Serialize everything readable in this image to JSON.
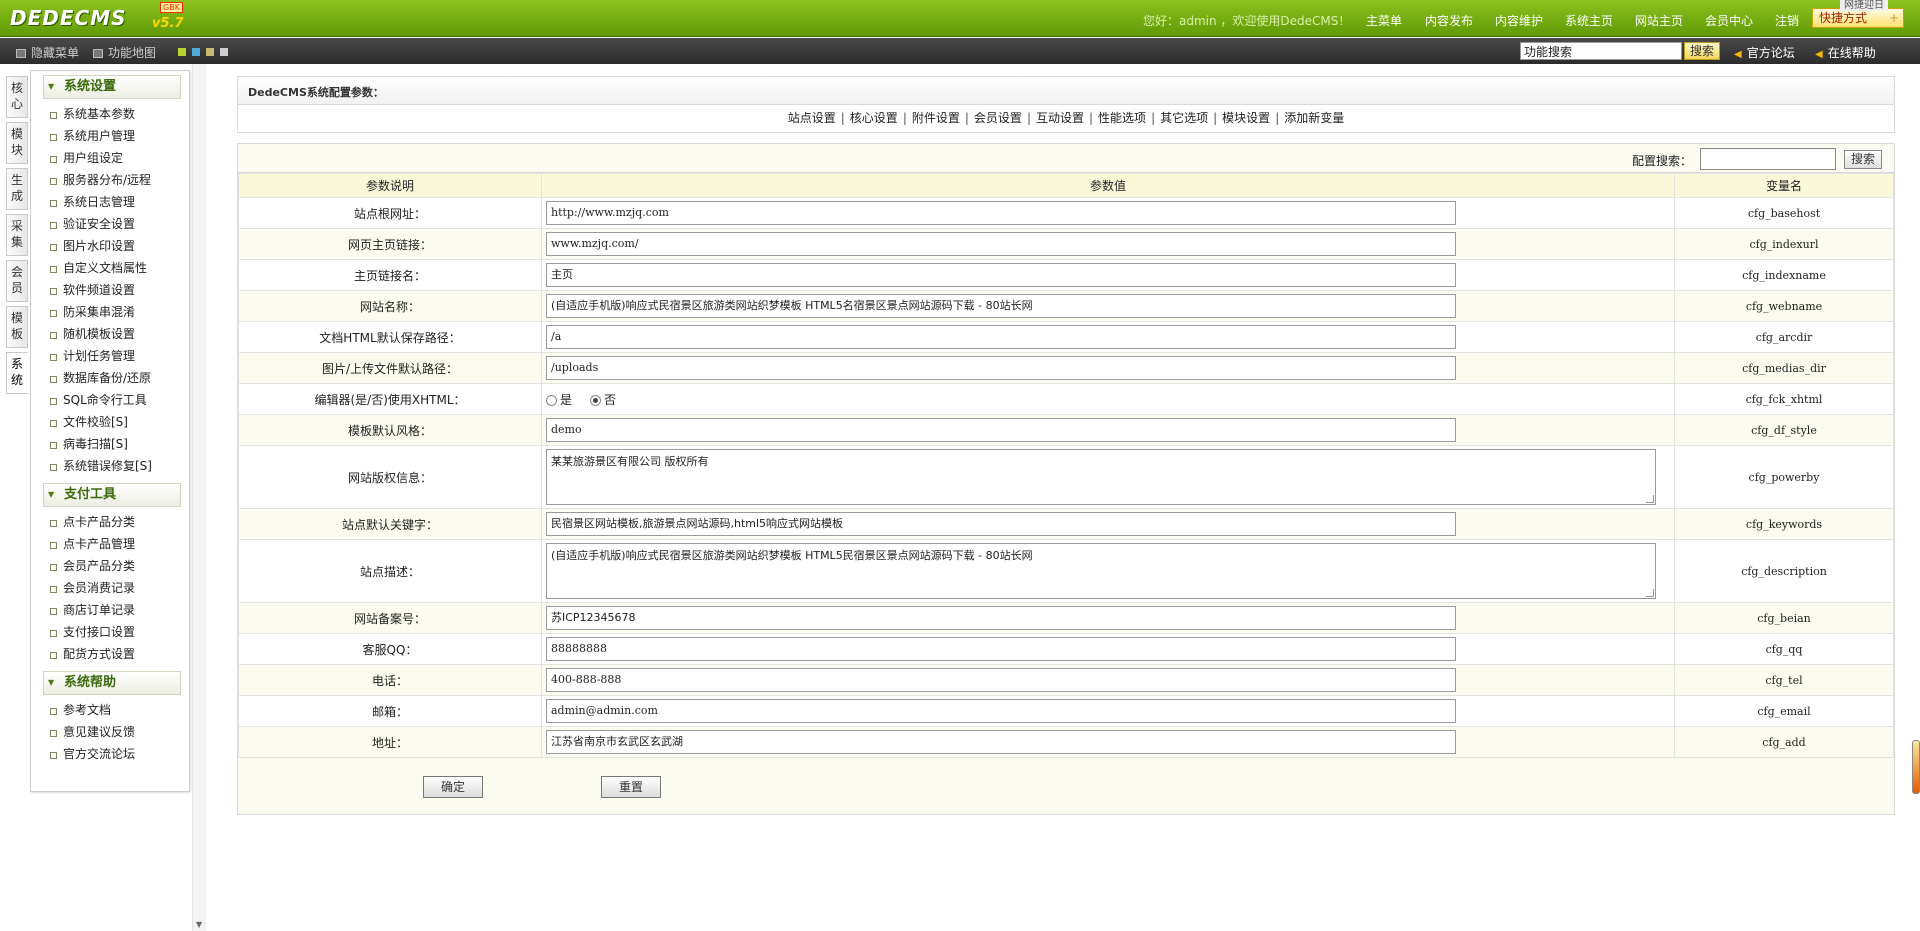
{
  "header": {
    "logo": "DEDECMS",
    "version": "v5.7",
    "edition_badge": "GBK",
    "welcome": "您好：admin ，欢迎使用DedeCMS！",
    "nav": [
      "主菜单",
      "内容发布",
      "内容维护",
      "系统主页",
      "网站主页",
      "会员中心",
      "注销"
    ],
    "quick_label": "快捷方式",
    "quick_tip": "网捷迎日"
  },
  "toolbar": {
    "hide_menu": "隐藏菜单",
    "func_map": "功能地图",
    "search_value": "功能搜索",
    "search_btn": "搜索",
    "forum": "官方论坛",
    "help": "在线帮助",
    "swatch_colors": [
      "#b8d430",
      "#4fa8d8",
      "#c9b870",
      "#cfcfcf"
    ]
  },
  "vtabs": [
    {
      "label": "核心",
      "active": false
    },
    {
      "label": "模块",
      "active": false
    },
    {
      "label": "生成",
      "active": false
    },
    {
      "label": "采集",
      "active": false
    },
    {
      "label": "会员",
      "active": false
    },
    {
      "label": "模板",
      "active": false
    },
    {
      "label": "系统",
      "active": true
    }
  ],
  "menu": [
    {
      "title": "系统设置",
      "items": [
        "系统基本参数",
        "系统用户管理",
        "用户组设定",
        "服务器分布/远程",
        "系统日志管理",
        "验证安全设置",
        "图片水印设置",
        "自定义文档属性",
        "软件频道设置",
        "防采集串混淆",
        "随机模板设置",
        "计划任务管理",
        "数据库备份/还原",
        "SQL命令行工具",
        "文件校验[S]",
        "病毒扫描[S]",
        "系统错误修复[S]"
      ]
    },
    {
      "title": "支付工具",
      "items": [
        "点卡产品分类",
        "点卡产品管理",
        "会员产品分类",
        "会员消费记录",
        "商店订单记录",
        "支付接口设置",
        "配货方式设置"
      ]
    },
    {
      "title": "系统帮助",
      "items": [
        "参考文档",
        "意见建议反馈",
        "官方交流论坛"
      ]
    }
  ],
  "main": {
    "title": "DedeCMS系统配置参数：",
    "tabs": [
      "站点设置",
      "核心设置",
      "附件设置",
      "会员设置",
      "互动设置",
      "性能选项",
      "其它选项",
      "模块设置",
      "添加新变量"
    ],
    "search_label": "配置搜索：",
    "search_btn": "搜索",
    "columns": [
      "参数说明",
      "参数值",
      "变量名"
    ],
    "rows": [
      {
        "label": "站点根网址：",
        "value": "http://www.mzjq.com",
        "var": "cfg_basehost",
        "type": "input"
      },
      {
        "label": "网页主页链接：",
        "value": "www.mzjq.com/",
        "var": "cfg_indexurl",
        "type": "input"
      },
      {
        "label": "主页链接名：",
        "value": "主页",
        "var": "cfg_indexname",
        "type": "input"
      },
      {
        "label": "网站名称：",
        "value": "(自适应手机版)响应式民宿景区旅游类网站织梦模板 HTML5名宿景区景点网站源码下载 - 80站长网",
        "var": "cfg_webname",
        "type": "input"
      },
      {
        "label": "文档HTML默认保存路径：",
        "value": "/a",
        "var": "cfg_arcdir",
        "type": "input"
      },
      {
        "label": "图片/上传文件默认路径：",
        "value": "/uploads",
        "var": "cfg_medias_dir",
        "type": "input"
      },
      {
        "label": "编辑器(是/否)使用XHTML：",
        "value": "",
        "var": "cfg_fck_xhtml",
        "type": "radio",
        "options": [
          "是",
          "否"
        ],
        "selected": 1
      },
      {
        "label": "模板默认风格：",
        "value": "demo",
        "var": "cfg_df_style",
        "type": "input"
      },
      {
        "label": "网站版权信息：",
        "value": "某某旅游景区有限公司 版权所有",
        "var": "cfg_powerby",
        "type": "textarea"
      },
      {
        "label": "站点默认关键字：",
        "value": "民宿景区网站模板,旅游景点网站源码,html5响应式网站模板",
        "var": "cfg_keywords",
        "type": "input"
      },
      {
        "label": "站点描述：",
        "value": "(自适应手机版)响应式民宿景区旅游类网站织梦模板 HTML5民宿景区景点网站源码下载 - 80站长网",
        "var": "cfg_description",
        "type": "textarea"
      },
      {
        "label": "网站备案号：",
        "value": "苏ICP12345678",
        "var": "cfg_beian",
        "type": "input"
      },
      {
        "label": "客服QQ：",
        "value": "88888888",
        "var": "cfg_qq",
        "type": "input"
      },
      {
        "label": "电话：",
        "value": "400-888-888",
        "var": "cfg_tel",
        "type": "input"
      },
      {
        "label": "邮箱：",
        "value": "admin@admin.com",
        "var": "cfg_email",
        "type": "input"
      },
      {
        "label": "地址：",
        "value": "江苏省南京市玄武区玄武湖",
        "var": "cfg_add",
        "type": "input"
      }
    ],
    "ok_btn": "确定",
    "reset_btn": "重置"
  }
}
